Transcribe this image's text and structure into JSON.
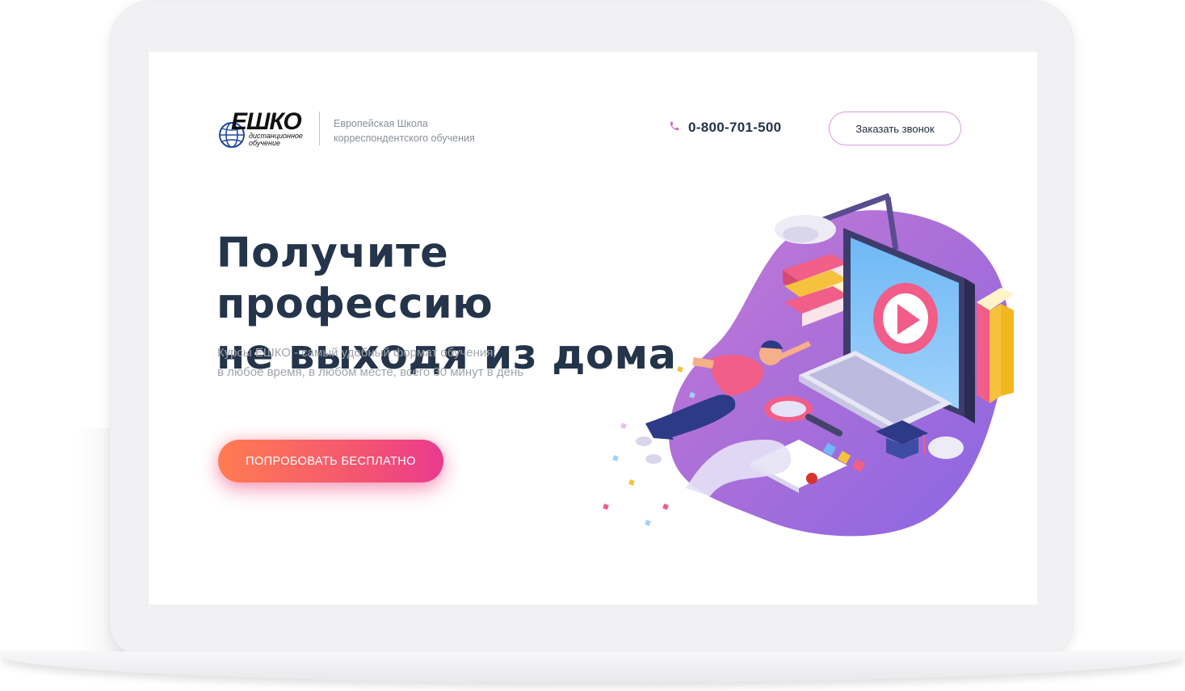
{
  "header": {
    "logo_word": "ЕШКО",
    "logo_sub_line1": "дистанционное",
    "logo_sub_line2": "обучение",
    "school_line1": "Европейская Школа",
    "school_line2": "корреспондентского обучения",
    "phone": "0-800-701-500",
    "callback_label": "Заказать звонок",
    "phone_icon": "phone-icon"
  },
  "hero": {
    "title_line1": "Получите профессию",
    "title_line2": "не выходя из дома",
    "subtitle_line1": "Курсы ЕШКО - самый удобный формат обучения:",
    "subtitle_line2": "в любое время, в любом месте, всего 30 минут в день",
    "cta_label": "ПОПРОБОВАТЬ БЕСПЛАТНО"
  },
  "colors": {
    "title": "#24344a",
    "accent_pink": "#d79ed8",
    "cta_start": "#ff7c52",
    "cta_end": "#ea3a8e",
    "blob_purple": "#9b6fe0"
  }
}
